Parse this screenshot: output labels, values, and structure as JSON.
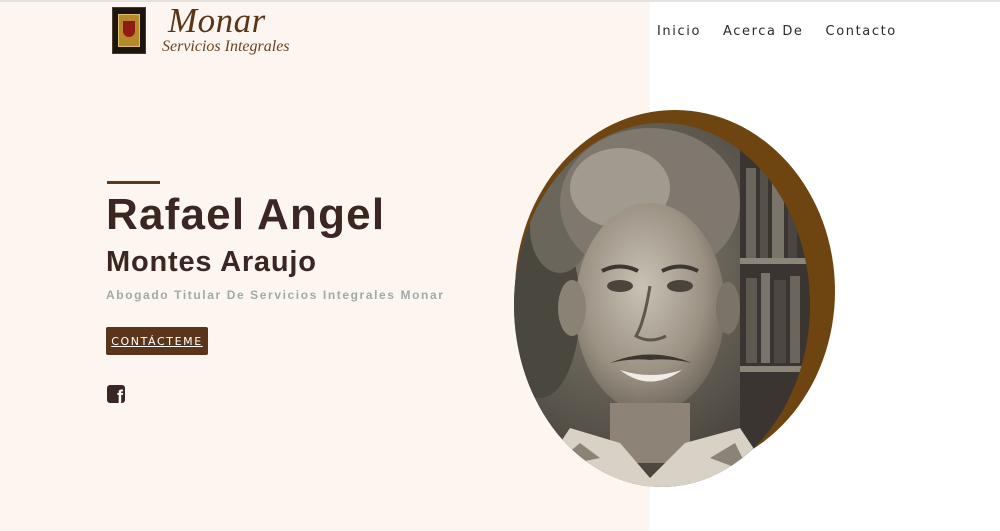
{
  "brand": {
    "title": "Monar",
    "subtitle": "Servicios Integrales",
    "crest_icon": "crest-logo-icon"
  },
  "nav": {
    "items": [
      "Inicio",
      "Acerca De",
      "Contacto"
    ]
  },
  "hero": {
    "name_line1": "Rafael Angel",
    "name_line2": "Montes Araujo",
    "subtitle": "Abogado Titular De Servicios Integrales Monar",
    "cta_label": "CONTÁCTEME",
    "social_icon": "facebook-icon",
    "photo": "portrait-photo"
  },
  "colors": {
    "accent": "#5b3519",
    "heading": "#3b2621",
    "subtitle": "#a2aaa6",
    "left_background": "#fdf5f0",
    "ring": "#6e4510"
  }
}
